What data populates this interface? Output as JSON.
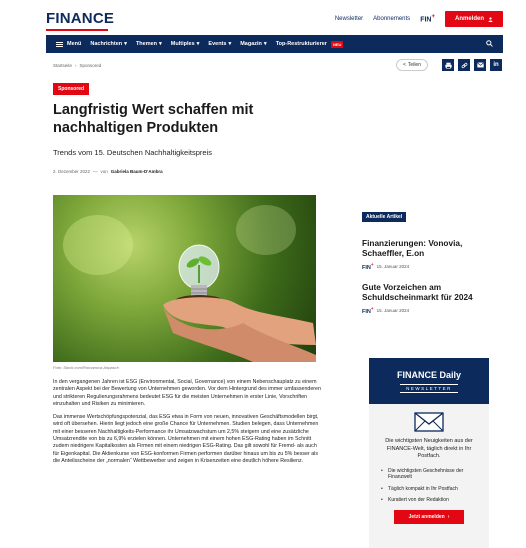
{
  "header": {
    "logo": "FINANCE",
    "links": [
      "Newsletter",
      "Abonnements"
    ],
    "fin_label": "FIN",
    "fin_plus": "+",
    "login_label": "Anmelden",
    "login_icon": "user-icon"
  },
  "nav": {
    "menu_label": "Menü",
    "items": [
      {
        "label": "Nachrichten"
      },
      {
        "label": "Themen"
      },
      {
        "label": "Multiples"
      },
      {
        "label": "Events"
      },
      {
        "label": "Magazin"
      },
      {
        "label": "Top-Restrukturierer"
      }
    ],
    "new_badge": "NEU",
    "search_icon": "search-icon"
  },
  "breadcrumb": [
    "Startseite",
    "Sponsored"
  ],
  "share": {
    "share_label": "Teilen",
    "buttons": [
      "print-icon",
      "link-icon",
      "mail-icon",
      "linkedin-icon"
    ],
    "linkedin_text": "in"
  },
  "article": {
    "badge": "Sponsored",
    "title": "Langfristig Wert schaffen mit nachhaltigen Produkten",
    "subtitle": "Trends vom 15. Deutschen Nachhaltigkeitspreis",
    "date": "2. Dezember 2022",
    "separator": "—",
    "by_prefix": "von",
    "author": "Gabriela Baum-D'Ambra",
    "caption": "Foto: Stock.com/Romanova Anpasch",
    "paragraphs": [
      "In den vergangenen Jahren ist ESG (Environmental, Social, Governance) von einem Nebenschauplatz zu einem zentralen Aspekt bei der Bewertung von Unternehmen geworden. Vor dem Hintergrund des immer umfassenderen und strikteren Regulierungsrahmens bedeutet ESG für die meisten Unternehmen in erster Linie, Vorschriften einzuhalten und Risiken zu minimieren.",
      "Das immense Wertschöpfungspotenzial, das ESG etwa in Form von neuen, innovativen Geschäftsmodellen birgt, wird oft übersehen. Hierin liegt jedoch eine große Chance für Unternehmen. Studien belegen, dass Unternehmen mit einer besseren Nachhaltigkeits-Performance ihr Umsatzwachstum um 2,5% steigern und eine zusätzliche Umsatzrendite von bis zu 6,9% erzielen können. Unternehmen mit einem hohen ESG-Rating haben im Schnitt zudem niedrigere Kapitalkosten als Firmen mit einem niedrigen ESG-Rating. Das gilt sowohl für Fremd- als auch für Eigenkapital. Die Aktienkurse von ESG-konformen Firmen performen darüber hinaus um bis zu 5% besser als die Anteilsscheine der „normalen“ Wettbewerber und zeigen in Krisenzeiten eine deutlich höhere Resilienz."
    ]
  },
  "sidebar": {
    "label": "Aktuelle Artikel",
    "articles": [
      {
        "title": "Finanzierungen: Vonovia, Schaeffler, E.on",
        "source": "FIN",
        "date": "15. Januar 2024"
      },
      {
        "title": "Gute Vorzeichen am Schuldscheinmarkt für 2024",
        "source": "FIN",
        "date": "15. Januar 2024"
      }
    ],
    "newsletter": {
      "title": "FINANCE Daily",
      "subtitle": "NEWSLETTER",
      "description": "Die wichtigsten Neuigkeiten aus der FINANCE-Welt, täglich direkt in Ihr Postfach.",
      "bullets": [
        "Die wichtigsten Geschehnisse der Finanzwelt",
        "Täglich kompakt in Ihr Postfach",
        "Kuratiert von der Redaktion"
      ],
      "cta": "Jetzt anmelden",
      "cta_arrow": "›"
    }
  },
  "colors": {
    "brand_navy": "#0d2a5c",
    "brand_red": "#e30613"
  }
}
